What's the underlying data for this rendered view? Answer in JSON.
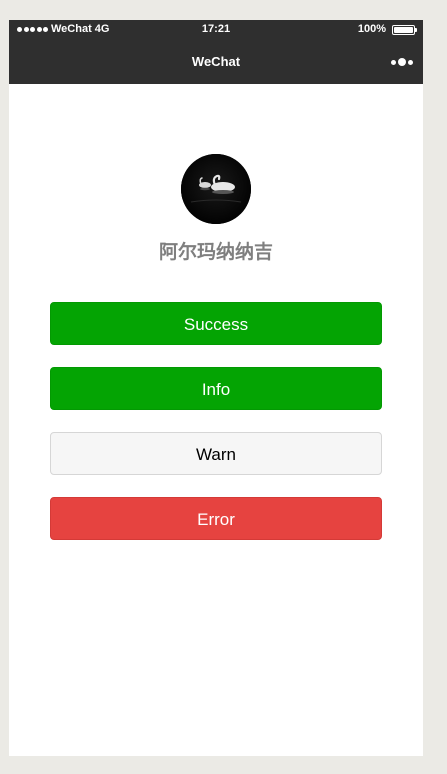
{
  "status_bar": {
    "carrier": "WeChat 4G",
    "time": "17:21",
    "battery": "100%",
    "battery_level": 1.0
  },
  "nav": {
    "title": "WeChat",
    "menu_icon": "more-dots-icon"
  },
  "profile": {
    "avatar_icon": "swan-avatar",
    "nickname": "阿尔玛纳纳吉"
  },
  "buttons": {
    "success": "Success",
    "info": "Info",
    "warn": "Warn",
    "error": "Error"
  },
  "colors": {
    "navbar": "#2f2f2f",
    "success": "#04a403",
    "warn_bg": "#f6f6f6",
    "error": "#e64340",
    "background": "#ebeae5"
  }
}
